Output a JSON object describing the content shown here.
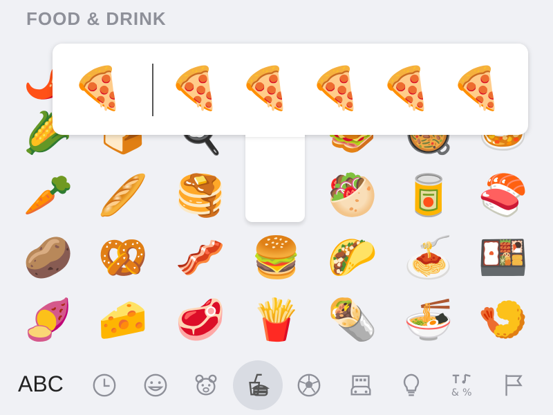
{
  "section_title": "FOOD & DRINK",
  "grid": {
    "rows": [
      [
        "🌶️",
        "",
        "",
        "",
        "",
        "",
        ""
      ],
      [
        "🌽",
        "🍞",
        "🍳",
        "",
        "🥪",
        "🥘",
        "🍛"
      ],
      [
        "🥕",
        "🥖",
        "🥞",
        "",
        "🥙",
        "🥫",
        "🍣"
      ],
      [
        "🥔",
        "🥨",
        "🥓",
        "🍔",
        "🌮",
        "🍝",
        "🍱"
      ],
      [
        "🍠",
        "🧀",
        "🥩",
        "🍟",
        "🌯",
        "🍜",
        "🍤"
      ]
    ]
  },
  "popup": {
    "variants": [
      "🍕",
      "🍕",
      "🍕",
      "🍕",
      "🍕",
      "🍕"
    ]
  },
  "bottom_bar": {
    "keyboard_switch_label": "ABC",
    "categories": [
      "recent-clock",
      "smileys",
      "animals",
      "food-drink",
      "activity",
      "travel",
      "objects",
      "symbols",
      "flags"
    ],
    "active_category": "food-drink"
  },
  "colors": {
    "background": "#f0f1f5",
    "section_title": "#8e9099",
    "icon_gray": "#8e9099",
    "active_category_bg": "#d9dce3"
  }
}
